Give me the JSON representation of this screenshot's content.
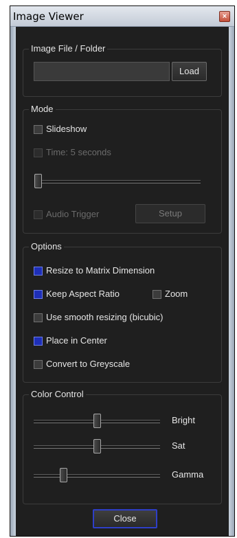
{
  "window": {
    "title": "Image Viewer",
    "close_glyph": "×",
    "close_icon": "close-x-icon"
  },
  "image_file": {
    "group_label": "Image File / Folder",
    "path_value": "",
    "load_label": "Load"
  },
  "mode": {
    "group_label": "Mode",
    "slideshow": {
      "label": "Slideshow",
      "checked": false
    },
    "time": {
      "label": "Time: 5 seconds",
      "checked": false,
      "disabled": true
    },
    "time_slider": {
      "value": 0.0
    },
    "audio_trigger": {
      "label": "Audio Trigger",
      "checked": false,
      "disabled": true
    },
    "setup_label": "Setup"
  },
  "options": {
    "group_label": "Options",
    "resize": {
      "label": "Resize to Matrix Dimension",
      "checked": true
    },
    "aspect": {
      "label": "Keep Aspect Ratio",
      "checked": true
    },
    "zoom": {
      "label": "Zoom",
      "checked": false
    },
    "smooth": {
      "label": "Use smooth resizing (bicubic)",
      "checked": false
    },
    "center": {
      "label": "Place in Center",
      "checked": true
    },
    "greyscale": {
      "label": "Convert to Greyscale",
      "checked": false
    }
  },
  "color_control": {
    "group_label": "Color Control",
    "bright": {
      "label": "Bright",
      "value": 0.5
    },
    "sat": {
      "label": "Sat",
      "value": 0.5
    },
    "gamma": {
      "label": "Gamma",
      "value": 0.22
    }
  },
  "close_label": "Close",
  "colors": {
    "accent": "#1e2fb8",
    "background": "#1f1f1f",
    "text": "#e6e6e6"
  }
}
